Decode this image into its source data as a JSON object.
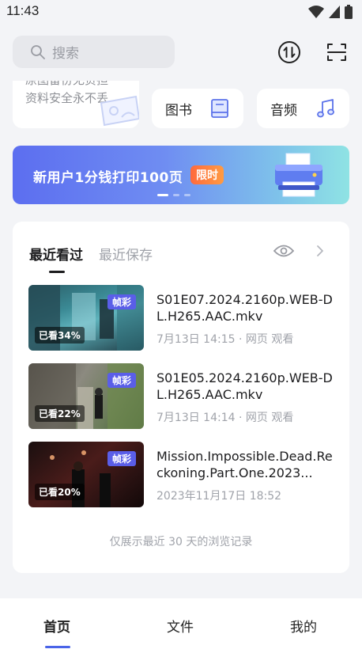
{
  "status_bar": {
    "time": "11:43"
  },
  "search": {
    "placeholder": "搜索"
  },
  "partial_card": {
    "line1": "原图备份无负担",
    "line2": "资料安全永不丢"
  },
  "quick_access": [
    {
      "label": "图书",
      "icon": "book-icon"
    },
    {
      "label": "音频",
      "icon": "music-note-icon"
    }
  ],
  "banner": {
    "text": "新用户1分钱打印100页",
    "badge": "限时"
  },
  "recent": {
    "tabs": [
      "最近看过",
      "最近保存"
    ],
    "items": [
      {
        "title": "S01E07.2024.2160p.WEB-DL.H265.AAC.mkv",
        "meta": "7月13日 14:15 · 网页 观看",
        "badge": "帧彩",
        "progress": "已看34%"
      },
      {
        "title": "S01E05.2024.2160p.WEB-DL.H265.AAC.mkv",
        "meta": "7月13日 14:14 · 网页 观看",
        "badge": "帧彩",
        "progress": "已看22%"
      },
      {
        "title": "Mission.Impossible.Dead.Reckoning.Part.One.2023...",
        "meta": "2023年11月17日 18:52",
        "badge": "帧彩",
        "progress": "已看20%"
      }
    ],
    "footnote": "仅展示最近 30 天的浏览记录"
  },
  "bottom_nav": [
    "首页",
    "文件",
    "我的"
  ],
  "colors": {
    "accent": "#4a64e8",
    "badge": "#5a5ee8",
    "banner_badge": "#ff7a3d"
  }
}
